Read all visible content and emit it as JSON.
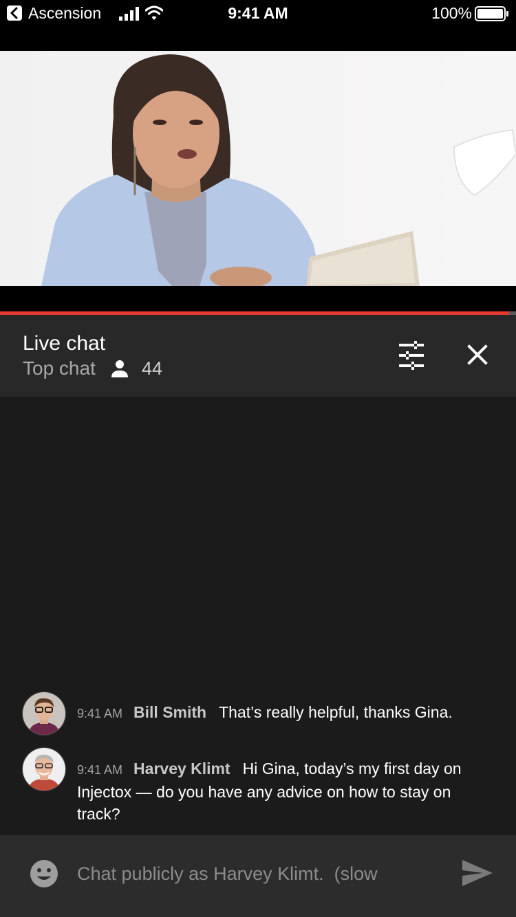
{
  "status_bar": {
    "carrier": "Ascension",
    "time": "9:41 AM",
    "battery": "100%"
  },
  "video": {
    "progress": 0.987
  },
  "chat_header": {
    "title": "Live chat",
    "mode": "Top chat",
    "viewer_count": "44"
  },
  "messages": [
    {
      "time": "9:41 AM",
      "author": "Bill Smith",
      "text": "That’s really helpful, thanks Gina."
    },
    {
      "time": "9:41 AM",
      "author": "Harvey Klimt",
      "text": "Hi Gina, today’s my first day on Injectox — do you have any advice on how to stay on track?"
    }
  ],
  "input": {
    "placeholder": "Chat publicly as Harvey Klimt.  (slow"
  },
  "colors": {
    "progress": "#e33b2e",
    "header_bg": "#282828",
    "chat_bg": "#1b1b1b",
    "input_bg": "#2c2c2c"
  },
  "icons": [
    "back-icon",
    "signal-icon",
    "wifi-icon",
    "battery-icon",
    "person-icon",
    "tune-icon",
    "close-icon",
    "emoji-icon",
    "send-icon"
  ]
}
